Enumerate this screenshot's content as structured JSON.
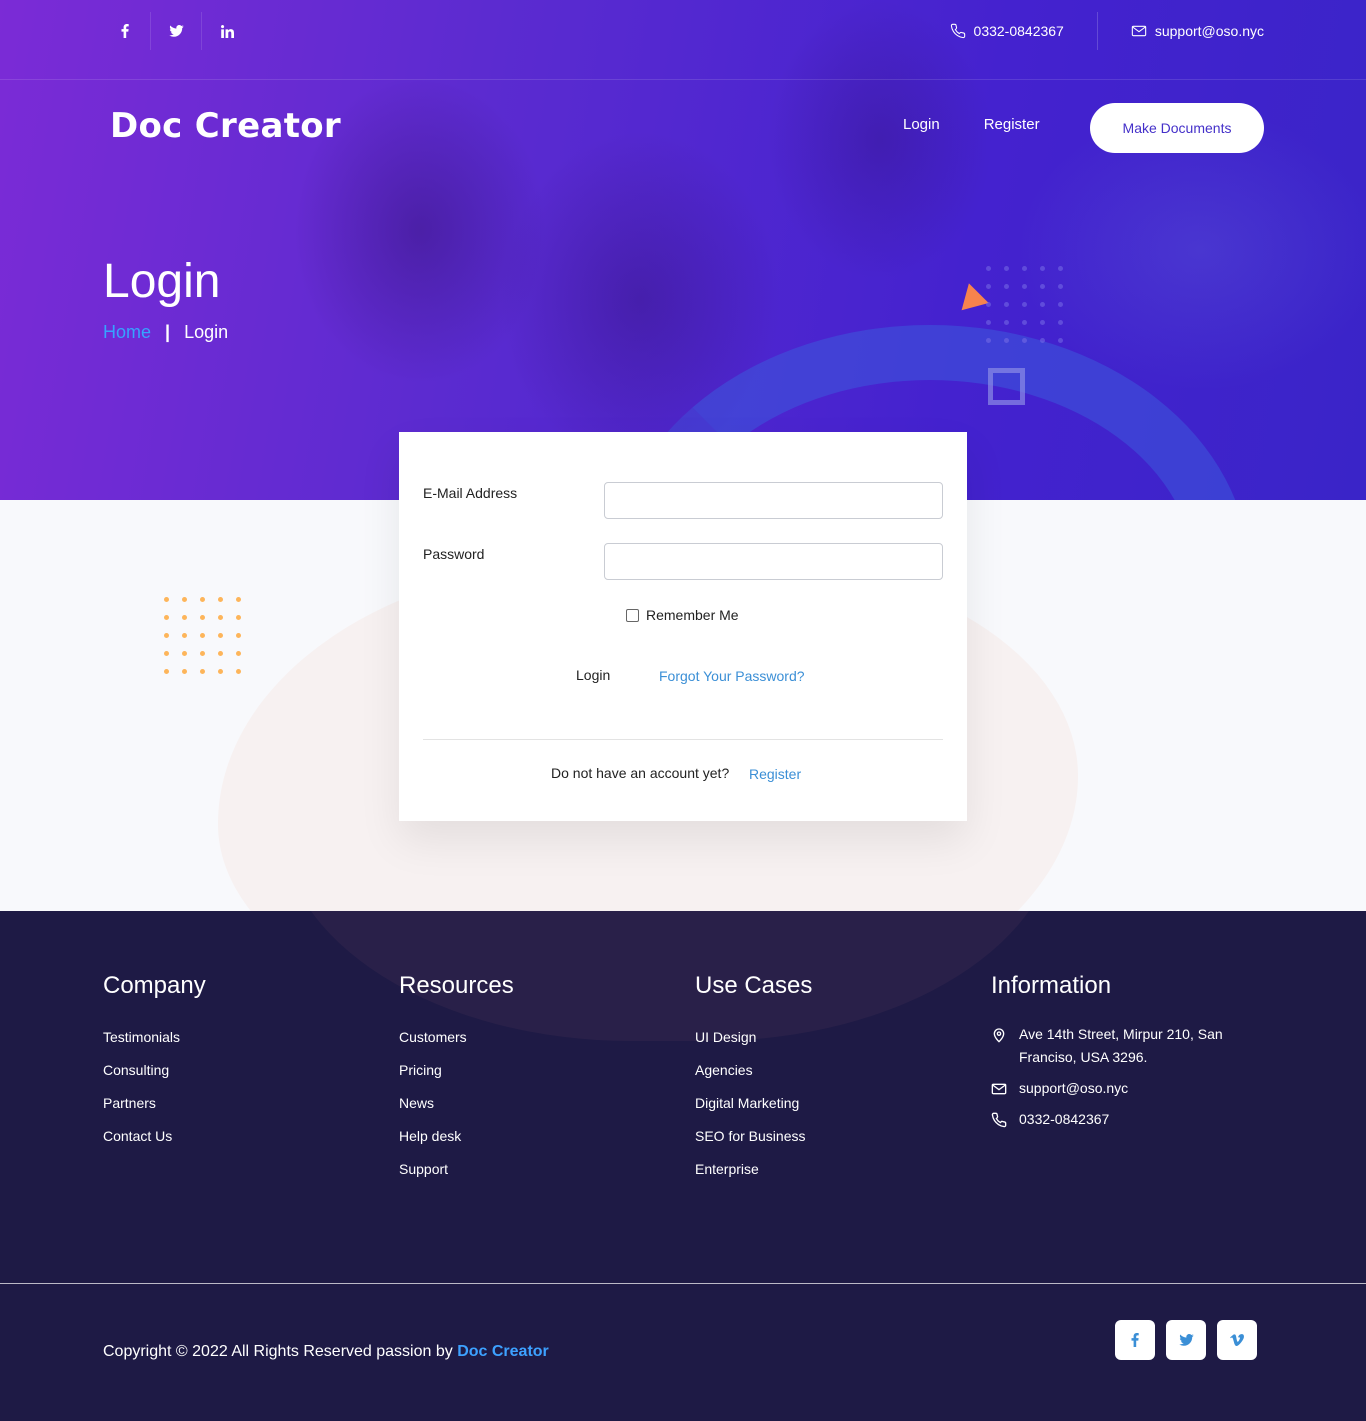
{
  "topbar": {
    "social": [
      "f",
      "t",
      "in"
    ],
    "phone": "0332-0842367",
    "email": "support@oso.nyc"
  },
  "header": {
    "logo": "Doc Creator",
    "nav": [
      "Login",
      "Register"
    ],
    "cta": "Make Documents"
  },
  "hero": {
    "title": "Login",
    "breadcrumb": {
      "home": "Home",
      "separator": "|",
      "current": "Login"
    }
  },
  "form": {
    "email_label": "E-Mail Address",
    "email_value": "",
    "password_label": "Password",
    "password_value": "",
    "remember_label": "Remember Me",
    "remember_checked": false,
    "login_label": "Login",
    "forgot_label": "Forgot Your Password?",
    "no_account_text": "Do not have an account yet?",
    "register_label": "Register"
  },
  "footer": {
    "columns": [
      {
        "title": "Company",
        "items": [
          "Testimonials",
          "Consulting",
          "Partners",
          "Contact Us"
        ]
      },
      {
        "title": "Resources",
        "items": [
          "Customers",
          "Pricing",
          "News",
          "Help desk",
          "Support"
        ]
      },
      {
        "title": "Use Cases",
        "items": [
          "UI Design",
          "Agencies",
          "Digital Marketing",
          "SEO for Business",
          "Enterprise"
        ]
      }
    ],
    "information": {
      "title": "Information",
      "address": "Ave 14th Street, Mirpur 210, San Franciso, USA 3296.",
      "email": "support@oso.nyc",
      "phone": "0332-0842367"
    },
    "copyright_prefix": "Copyright © 2022 All Rights Reserved passion by",
    "copyright_brand": "Doc Creator",
    "social": [
      "f",
      "t",
      "v"
    ]
  },
  "colors": {
    "hero_gradient_start": "#7b2bd6",
    "hero_gradient_end": "#3a24c8",
    "link_blue": "#3b8fd6",
    "footer_bg": "#1e1a45",
    "accent_orange": "#f7834d",
    "dots_orange": "#fdb55a"
  },
  "icons": [
    "facebook-icon",
    "twitter-icon",
    "linkedin-icon",
    "phone-icon",
    "mail-icon",
    "location-icon",
    "vimeo-icon"
  ]
}
